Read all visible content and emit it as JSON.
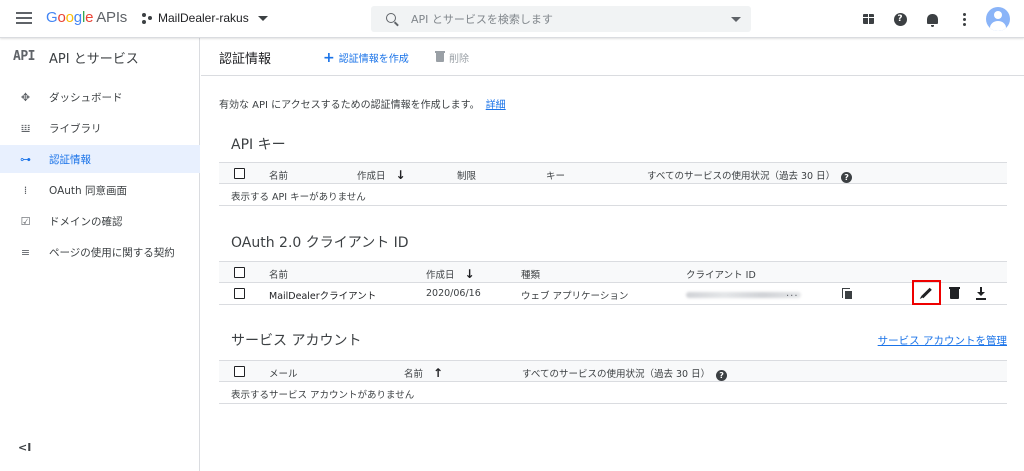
{
  "topbar": {
    "logo_google": "Google",
    "logo_apis": "APIs",
    "project_name": "MailDealer-rakus",
    "search_placeholder": "API とサービスを検索します"
  },
  "sidebar": {
    "badge": "API",
    "title": "API とサービス",
    "items": [
      {
        "label": "ダッシュボード",
        "icon": "dashboard-icon",
        "glyph": "✥"
      },
      {
        "label": "ライブラリ",
        "icon": "library-icon",
        "glyph": "𝍔"
      },
      {
        "label": "認証情報",
        "icon": "key-icon",
        "glyph": "⊶",
        "active": true
      },
      {
        "label": "OAuth 同意画面",
        "icon": "consent-icon",
        "glyph": "⁞"
      },
      {
        "label": "ドメインの確認",
        "icon": "checkbox-icon",
        "glyph": "☑"
      },
      {
        "label": "ページの使用に関する契約",
        "icon": "settings-list-icon",
        "glyph": "≡"
      }
    ],
    "collapse": "<I"
  },
  "main": {
    "title": "認証情報",
    "create_label": "認証情報を作成",
    "delete_label": "削除",
    "intro_text": "有効な API にアクセスするための認証情報を作成します。",
    "intro_link": "詳細"
  },
  "api_keys": {
    "title": "API キー",
    "headers": {
      "name": "名前",
      "created": "作成日",
      "restriction": "制限",
      "key": "キー",
      "usage": "すべてのサービスの使用状況（過去 30 日）"
    },
    "empty": "表示する API キーがありません"
  },
  "oauth": {
    "title": "OAuth 2.0 クライアント ID",
    "headers": {
      "name": "名前",
      "created": "作成日",
      "type": "種類",
      "client_id": "クライアント ID"
    },
    "rows": [
      {
        "name": "MailDealerクライアント",
        "created": "2020/06/16",
        "type": "ウェブ アプリケーション",
        "client_id_suffix": "..."
      }
    ]
  },
  "service_accounts": {
    "title": "サービス アカウント",
    "manage_link": "サービス アカウントを管理",
    "headers": {
      "email": "メール",
      "name": "名前",
      "usage": "すべてのサービスの使用状況（過去 30 日）"
    },
    "empty": "表示するサービス アカウントがありません"
  }
}
